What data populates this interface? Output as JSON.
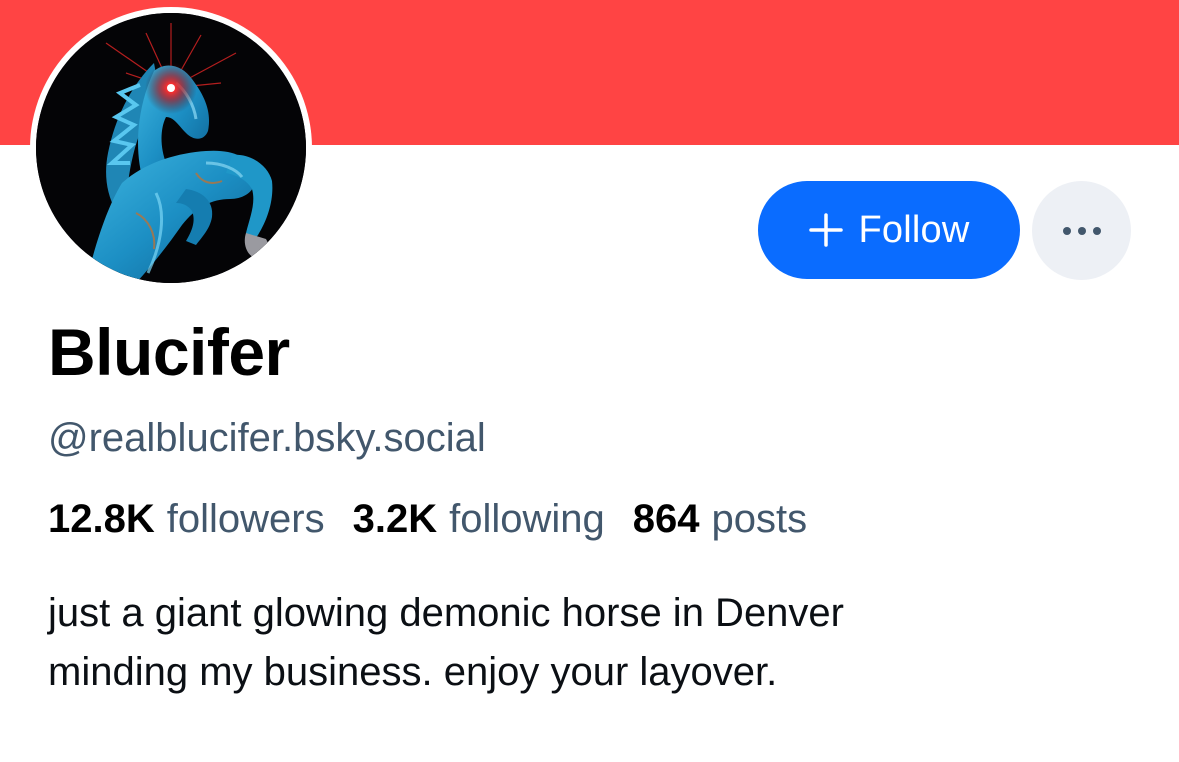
{
  "profile": {
    "display_name": "Blucifer",
    "handle": "@realblucifer.bsky.social",
    "bio_lines": [
      "just a giant glowing demonic horse in Denver",
      "minding my business. enjoy your layover."
    ],
    "avatar": "blue-mustang-sculpture-with-red-glowing-eye"
  },
  "stats": {
    "followers": {
      "count": "12.8K",
      "label": "followers"
    },
    "following": {
      "count": "3.2K",
      "label": "following"
    },
    "posts": {
      "count": "864",
      "label": "posts"
    }
  },
  "actions": {
    "follow_label": "Follow",
    "follow_icon": "plus-icon",
    "more_icon": "ellipsis-icon"
  },
  "colors": {
    "banner": "#ff4444",
    "follow_button": "#0a6cff",
    "more_button": "#edf0f5",
    "secondary_text": "#42576c"
  }
}
